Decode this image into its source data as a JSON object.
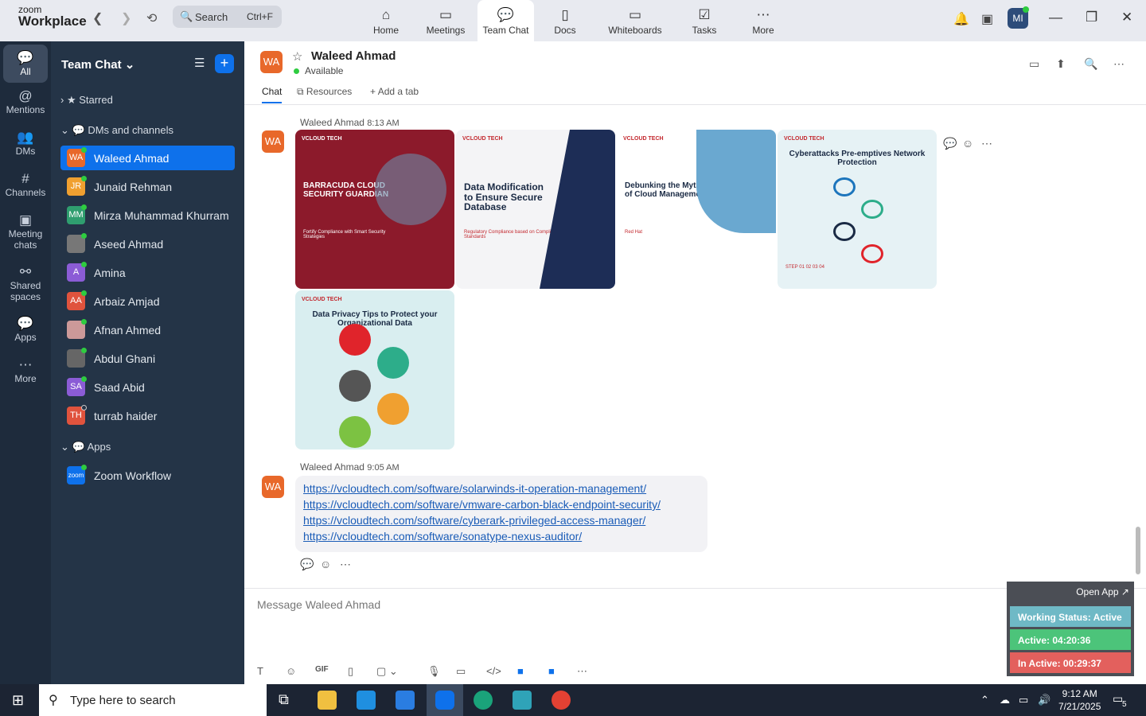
{
  "app": {
    "brand_small": "zoom",
    "brand": "Workplace",
    "search_placeholder": "Search",
    "search_shortcut": "Ctrl+F",
    "me_initials": "MI"
  },
  "tabs": [
    {
      "label": "Home",
      "icon": "home-icon"
    },
    {
      "label": "Meetings",
      "icon": "video-icon"
    },
    {
      "label": "Team Chat",
      "icon": "chat-icon"
    },
    {
      "label": "Docs",
      "icon": "doc-icon"
    },
    {
      "label": "Whiteboards",
      "icon": "whiteboard-icon"
    },
    {
      "label": "Tasks",
      "icon": "tasks-icon"
    },
    {
      "label": "More",
      "icon": "more-icon"
    }
  ],
  "rail": [
    {
      "label": "All"
    },
    {
      "label": "Mentions"
    },
    {
      "label": "DMs"
    },
    {
      "label": "Channels"
    },
    {
      "label": "Meeting chats"
    },
    {
      "label": "Shared spaces"
    },
    {
      "label": "Apps"
    },
    {
      "label": "More"
    }
  ],
  "sidebar": {
    "title": "Team Chat",
    "starred": "Starred",
    "dms_section": "DMs and channels",
    "apps_section": "Apps",
    "contacts": [
      {
        "initials": "WA",
        "name": "Waleed Ahmad",
        "color": "#e8682a"
      },
      {
        "initials": "JR",
        "name": "Junaid Rehman",
        "color": "#f0a030"
      },
      {
        "initials": "MM",
        "name": "Mirza Muhammad Khurram",
        "color": "#2f9e6f"
      },
      {
        "initials": "",
        "name": "Aseed Ahmad",
        "color": "#777"
      },
      {
        "initials": "A",
        "name": "Amina",
        "color": "#8b5cd6"
      },
      {
        "initials": "AA",
        "name": "Arbaiz Amjad",
        "color": "#e0533d"
      },
      {
        "initials": "",
        "name": "Afnan Ahmed",
        "color": "#c99"
      },
      {
        "initials": "",
        "name": "Abdul Ghani",
        "color": "#666"
      },
      {
        "initials": "SA",
        "name": "Saad Abid",
        "color": "#8b5cd6"
      },
      {
        "initials": "TH",
        "name": "turrab haider",
        "color": "#e0533d"
      }
    ],
    "app_item": "Zoom Workflow",
    "app_item_icon": "zoom"
  },
  "chat": {
    "contact": "Waleed Ahmad",
    "initials": "WA",
    "status": "Available",
    "tab_chat": "Chat",
    "tab_resources": "Resources",
    "tab_add": "Add a tab",
    "msg1_sender": "Waleed Ahmad",
    "msg1_time": "8:13 AM",
    "msg2_sender": "Waleed Ahmad",
    "msg2_time": "9:05 AM",
    "links": [
      "https://vcloudtech.com/software/solarwinds-it-operation-management/",
      "https://vcloudtech.com/software/vmware-carbon-black-endpoint-security/",
      "https://vcloudtech.com/software/cyberark-privileged-access-manager/",
      "https://vcloudtech.com/software/sonatype-nexus-auditor/"
    ],
    "images": [
      {
        "brand": "VCLOUD TECH",
        "title": "BARRACUDA CLOUD SECURITY GUARDIAN",
        "sub": "Fortify Compliance with Smart Security Strategies",
        "bg": "#8c1a2b"
      },
      {
        "brand": "VCLOUD TECH",
        "title": "Data Modification to Ensure Secure Database",
        "sub": "Regulatory Compliance based on Compliance Standards",
        "bg": "#f4f4f6"
      },
      {
        "brand": "VCLOUD TECH",
        "title": "Debunking the Myths of Cloud Management",
        "sub": "Red Hat",
        "bg": "#ffffff"
      },
      {
        "brand": "VCLOUD TECH",
        "title": "Cyberattacks Pre-emptives Network Protection",
        "sub": "STEP 01 02 03 04",
        "bg": "#e6f2f5"
      },
      {
        "brand": "VCLOUD TECH",
        "title": "Data Privacy Tips to Protect your Organizational Data",
        "sub": "",
        "bg": "#d9eef0"
      }
    ],
    "composer_placeholder": "Message Waleed Ahmad"
  },
  "widget": {
    "open_app": "Open App ↗",
    "working": "Working Status: Active",
    "active": "Active: 04:20:36",
    "inactive": "In Active: 00:29:37"
  },
  "taskbar": {
    "search": "Type here to search",
    "time": "9:12 AM",
    "date": "7/21/2025",
    "notif": "5"
  }
}
